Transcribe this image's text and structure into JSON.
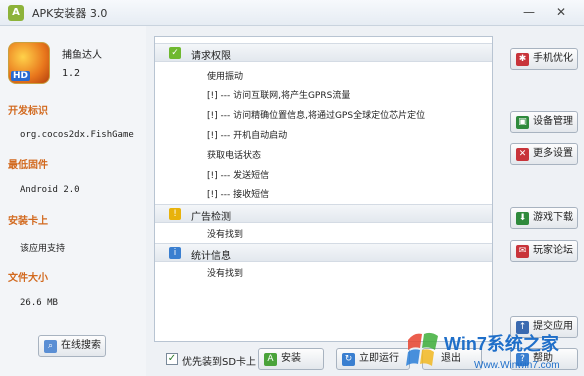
{
  "window": {
    "title": "APK安装器 3.0",
    "icon": "android-icon",
    "controls": [
      "—",
      "✕"
    ]
  },
  "app_info": {
    "name": "捕鱼达人",
    "version": "1.2",
    "logo_badge": "HD",
    "sections": [
      {
        "label": "开发标识",
        "value": "org.cocos2dx.FishGame"
      },
      {
        "label": "最低固件",
        "value": "Android 2.0"
      },
      {
        "label": "安装卡上",
        "value": "该应用支持"
      },
      {
        "label": "文件大小",
        "value": "26.6 MB"
      }
    ],
    "online_search_label": "在线搜索"
  },
  "groups": [
    {
      "title": "请求权限",
      "icon": "check-icon",
      "color": "#6fb830",
      "items": [
        "使用振动",
        "[!] --- 访问互联网,将产生GPRS流量",
        "[!] --- 访问精确位置信息,将通过GPS全球定位芯片定位",
        "[!] --- 开机自动启动",
        "获取电话状态",
        "[!] --- 发送短信",
        "[!] --- 接收短信"
      ]
    },
    {
      "title": "广告检测",
      "icon": "warning-icon",
      "color": "#e8b20c",
      "items": [
        "没有找到"
      ]
    },
    {
      "title": "统计信息",
      "icon": "info-icon",
      "color": "#3a7fd0",
      "items": [
        "没有找到"
      ]
    }
  ],
  "bottom": {
    "sd_checkbox_label": "优先装到SD卡上",
    "sd_checked": true,
    "install_label": "安装",
    "run_now_label": "立即运行",
    "exit_label": "退出"
  },
  "right_buttons": [
    {
      "label": "手机优化",
      "icon": "optimize-icon",
      "color": "#c8343a"
    },
    {
      "label": "设备管理",
      "icon": "device-icon",
      "color": "#2f8a3c"
    },
    {
      "label": "更多设置",
      "icon": "settings-icon",
      "color": "#c8343a"
    },
    {
      "label": "游戏下载",
      "icon": "game-icon",
      "color": "#2f8a3c"
    },
    {
      "label": "玩家论坛",
      "icon": "forum-icon",
      "color": "#c8343a"
    },
    {
      "label": "提交应用",
      "icon": "submit-icon",
      "color": "#3a6ab0"
    },
    {
      "label": "帮助",
      "icon": "help-icon",
      "color": "#3a7fd0"
    }
  ],
  "watermark": {
    "brand": "Win7系统之家",
    "url": "Www.Winwin7.com"
  }
}
